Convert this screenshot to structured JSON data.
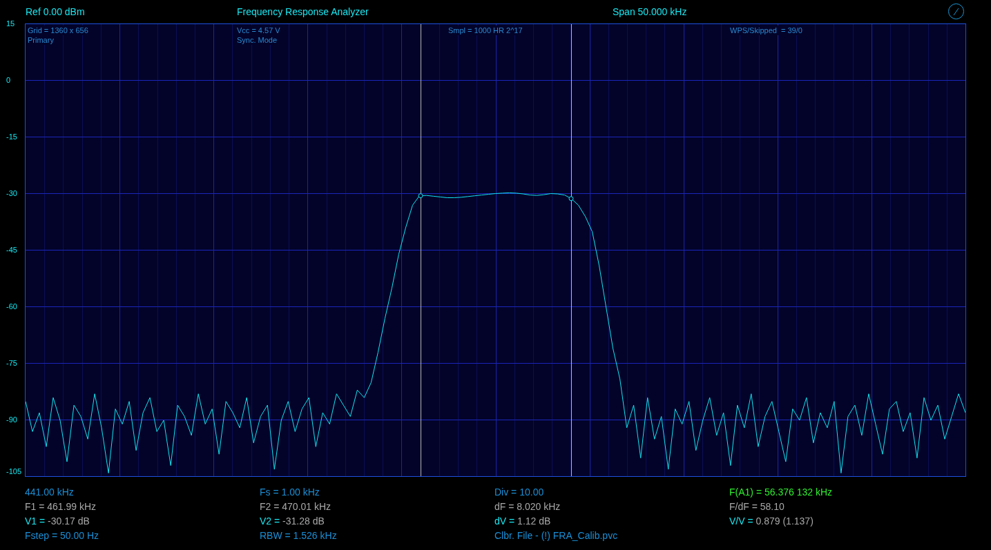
{
  "header": {
    "reference": "Ref  0.00 dBm",
    "title": "Frequency Response Analyzer",
    "span": "Span 50.000 kHz"
  },
  "chart_data": {
    "type": "line",
    "grid": true,
    "ylim": [
      -105,
      15
    ],
    "yticks": [
      15,
      0,
      -15,
      -30,
      -45,
      -60,
      -75,
      -90,
      -105
    ],
    "series": [
      {
        "color": "#12e6f0",
        "values": [
          -85,
          -93,
          -88,
          -97,
          -84,
          -90,
          -101,
          -86,
          -89,
          -95,
          -83,
          -92,
          -104,
          -87,
          -91,
          -85,
          -98,
          -88,
          -84,
          -93,
          -90,
          -102,
          -86,
          -89,
          -94,
          -83,
          -91,
          -87,
          -99,
          -85,
          -88,
          -92,
          -84,
          -96,
          -89,
          -86,
          -103,
          -90,
          -85,
          -93,
          -87,
          -84,
          -97,
          -88,
          -91,
          -83,
          -86,
          -89,
          -82,
          -84,
          -80,
          -72,
          -63,
          -55,
          -46,
          -39,
          -33,
          -30.5,
          -30.4,
          -30.6,
          -30.8,
          -31,
          -31,
          -30.9,
          -30.7,
          -30.5,
          -30.3,
          -30.1,
          -29.9,
          -29.8,
          -29.7,
          -29.8,
          -30,
          -30.3,
          -30.4,
          -30.2,
          -29.9,
          -30,
          -30.3,
          -31.3,
          -33,
          -36,
          -40,
          -49,
          -60,
          -71,
          -79,
          -92,
          -86,
          -100,
          -84,
          -95,
          -89,
          -103,
          -87,
          -91,
          -85,
          -98,
          -90,
          -84,
          -94,
          -88,
          -102,
          -86,
          -92,
          -83,
          -97,
          -89,
          -85,
          -93,
          -101,
          -87,
          -90,
          -84,
          -96,
          -88,
          -92,
          -85,
          -104,
          -89,
          -86,
          -94,
          -83,
          -91,
          -99,
          -87,
          -85,
          -93,
          -88,
          -100,
          -84,
          -90,
          -86,
          -95,
          -89,
          -83,
          -88
        ]
      }
    ]
  },
  "plot_overlay": [
    [
      "Grid = 1360 x 656",
      "Primary"
    ],
    [
      "Vcc = 4.57 V",
      "Sync. Mode"
    ],
    [
      "Smpl = 1000 HR 2^17"
    ],
    [
      "WPS/Skipped  = 39/0"
    ]
  ],
  "readouts": [
    [
      {
        "kind": "info",
        "text": "441.00 kHz"
      },
      {
        "kind": "plain",
        "text": "F1 = 461.99 kHz"
      },
      {
        "kind": "pair",
        "label": "V1 =",
        "value": "-30.17 dB"
      },
      {
        "kind": "info",
        "text": "Fstep = 50.00 Hz"
      }
    ],
    [
      {
        "kind": "info",
        "text": "Fs = 1.00 kHz"
      },
      {
        "kind": "plain",
        "text": "F2 = 470.01 kHz"
      },
      {
        "kind": "pair",
        "label": "V2 =",
        "value": "-31.28 dB"
      },
      {
        "kind": "info",
        "text": "RBW = 1.526 kHz"
      }
    ],
    [
      {
        "kind": "info",
        "text": "Div = 10.00"
      },
      {
        "kind": "plain",
        "text": "dF = 8.020 kHz"
      },
      {
        "kind": "pair",
        "label": "dV =",
        "value": "1.12 dB"
      },
      {
        "kind": "info",
        "text": "Clbr. File - (!) FRA_Calib.pvc"
      }
    ],
    [
      {
        "kind": "accent",
        "text": "F(A1) = 56.376 132 kHz"
      },
      {
        "kind": "plain",
        "text": "F/dF = 58.10"
      },
      {
        "kind": "pair",
        "label": "V/V =",
        "value": "0.879 (1.137)"
      }
    ]
  ]
}
